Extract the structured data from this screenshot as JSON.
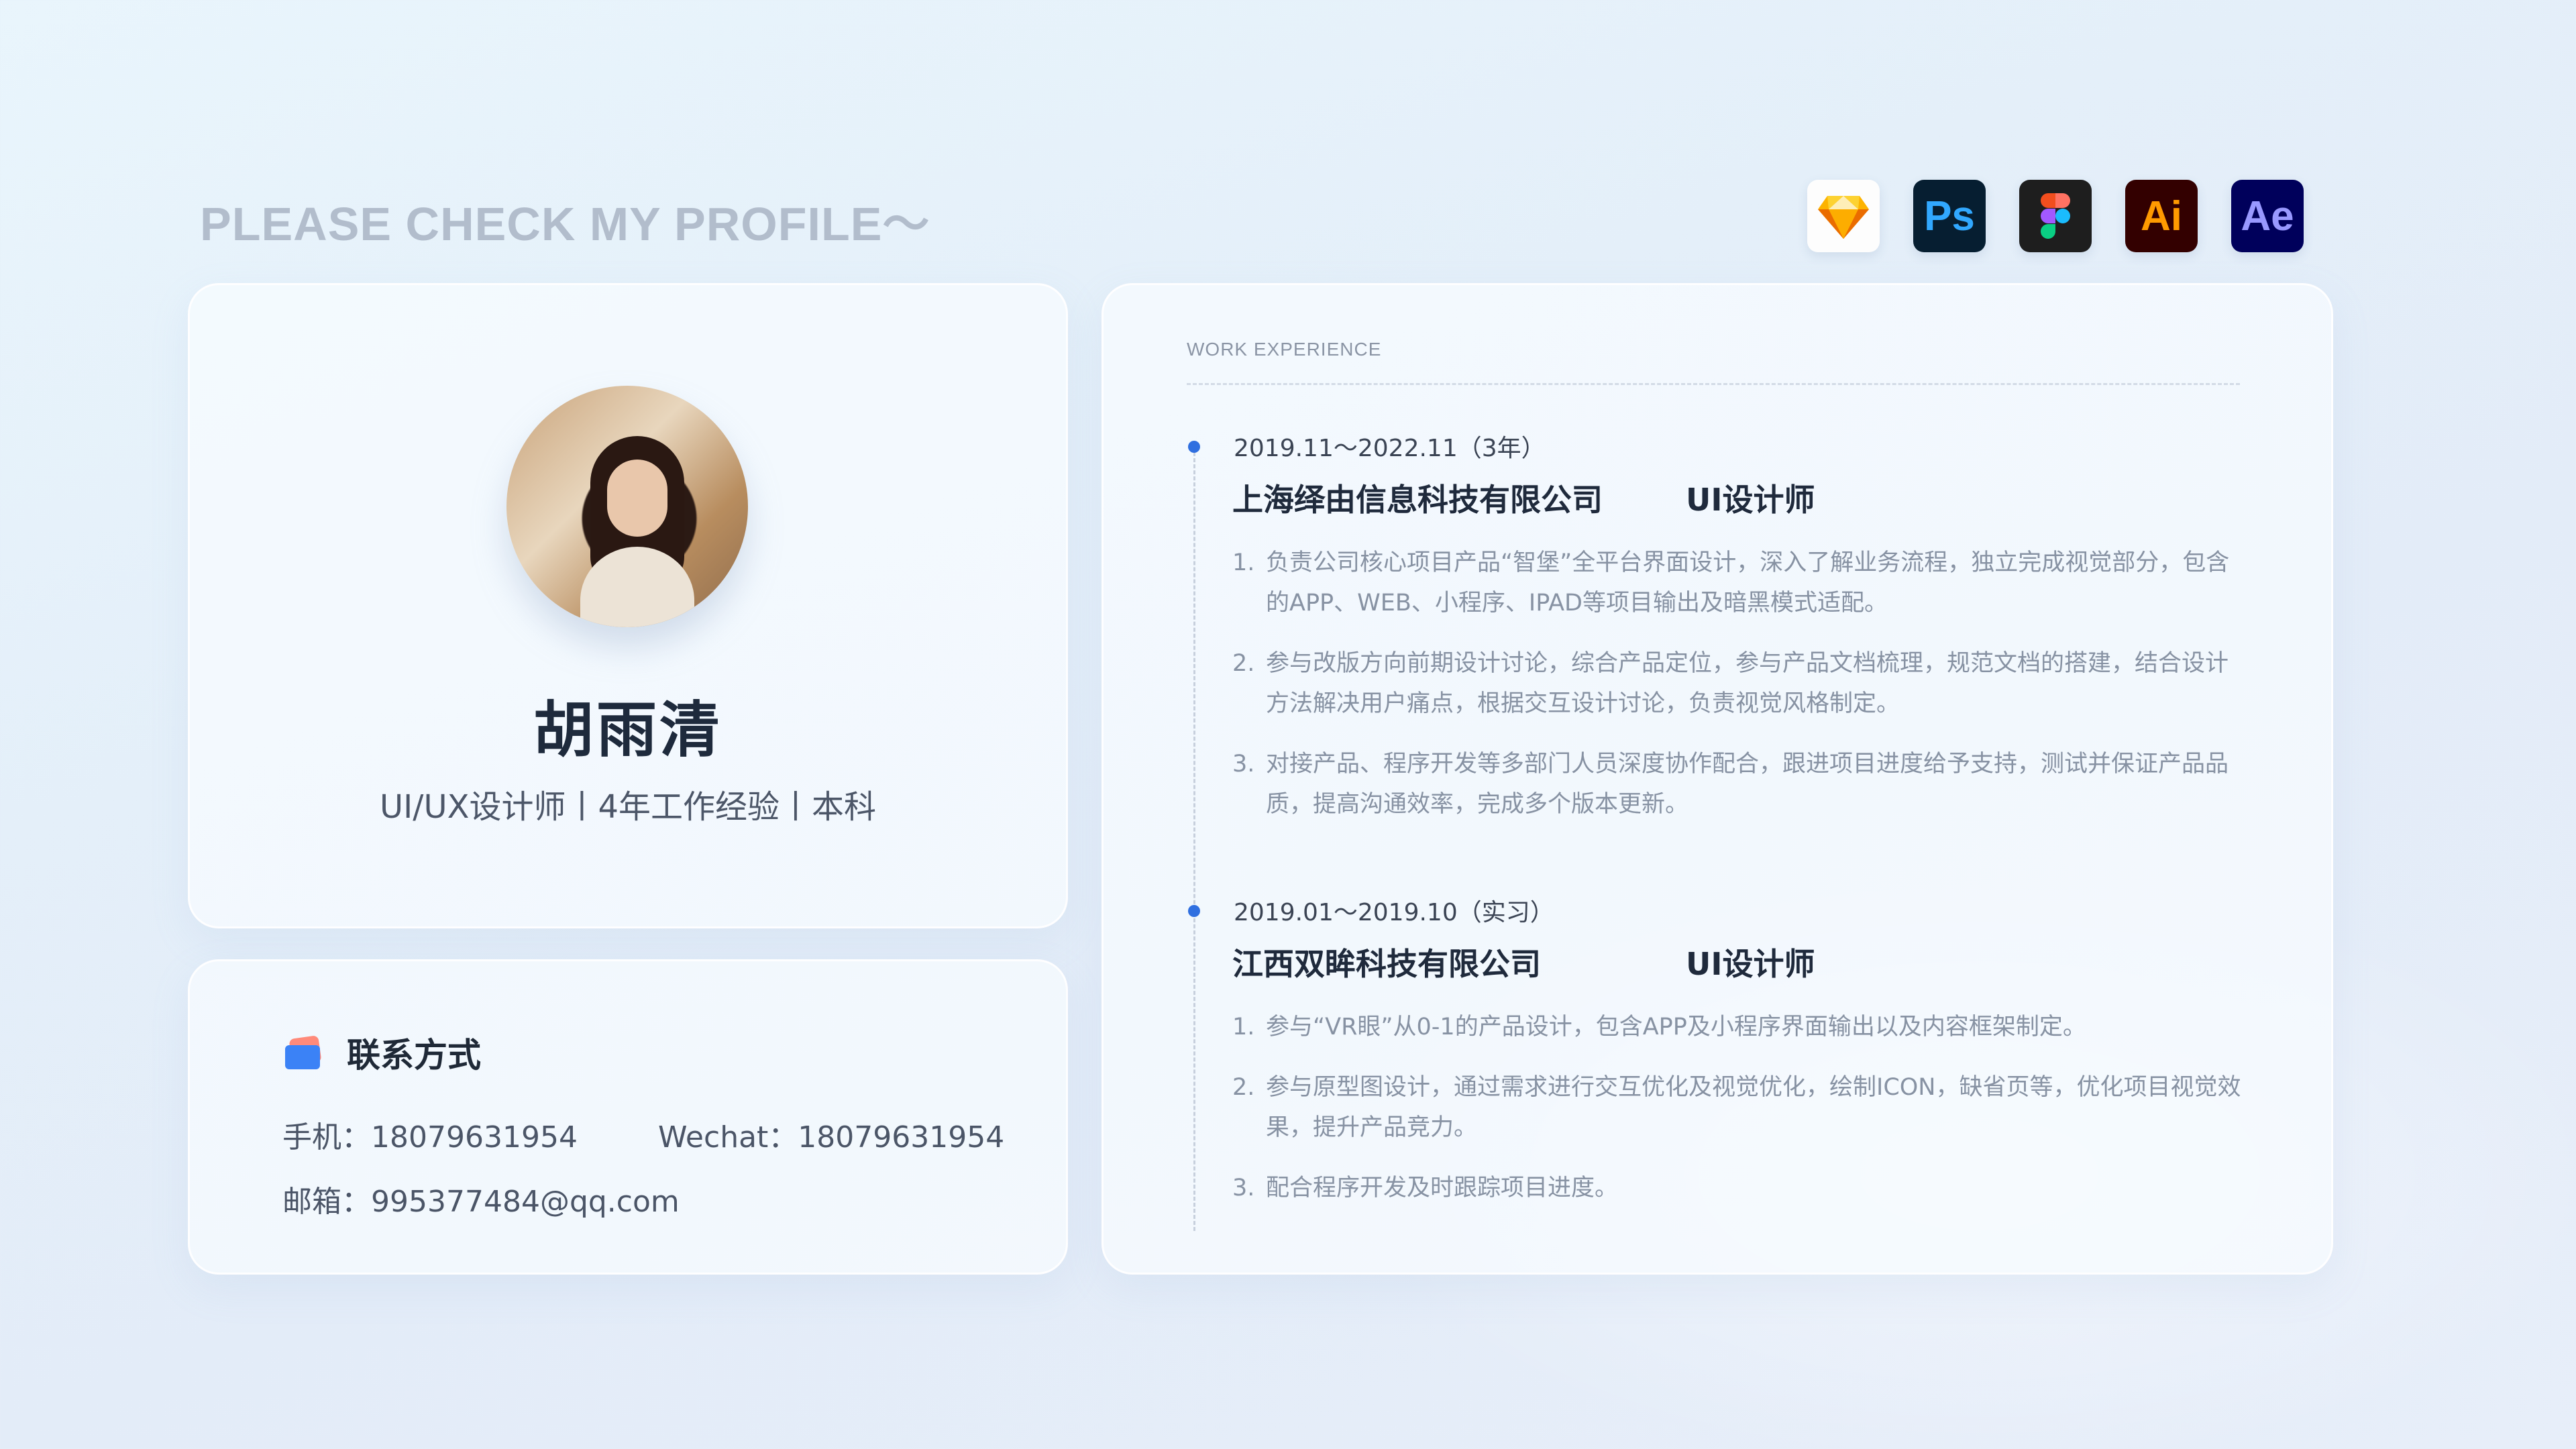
{
  "headline": "PLEASE CHECK MY PROFILE～",
  "tools": [
    {
      "name": "sketch-icon",
      "label": ""
    },
    {
      "name": "photoshop-icon",
      "label": "Ps"
    },
    {
      "name": "figma-icon",
      "label": ""
    },
    {
      "name": "illustrator-icon",
      "label": "Ai"
    },
    {
      "name": "after-effects-icon",
      "label": "Ae"
    }
  ],
  "profile": {
    "name": "胡雨清",
    "subtitle": "UI/UX设计师丨4年工作经验丨本科"
  },
  "contact": {
    "title": "联系方式",
    "phone": "手机：18079631954",
    "wechat": "Wechat：18079631954",
    "email": "邮箱：995377484@qq.com"
  },
  "work": {
    "label": "WORK EXPERIENCE",
    "jobs": [
      {
        "period": "2019.11～2022.11（3年）",
        "company": "上海绎由信息科技有限公司",
        "role": "UI设计师",
        "duties": [
          {
            "num": "1.",
            "text": "负责公司核心项目产品“智堡”全平台界面设计，深入了解业务流程，独立完成视觉部分，包含的APP、WEB、小程序、IPAD等项目输出及暗黑模式适配。"
          },
          {
            "num": "2.",
            "text": "参与改版方向前期设计讨论，综合产品定位，参与产品文档梳理，规范文档的搭建，结合设计方法解决用户痛点，根据交互设计讨论，负责视觉风格制定。"
          },
          {
            "num": "3.",
            "text": "对接产品、程序开发等多部门人员深度协作配合，跟进项目进度给予支持，测试并保证产品品质，提高沟通效率，完成多个版本更新。"
          }
        ]
      },
      {
        "period": "2019.01～2019.10（实习）",
        "company": "江西双眸科技有限公司",
        "role": "UI设计师",
        "duties": [
          {
            "num": "1.",
            "text": "参与“VR眼”从0-1的产品设计，包含APP及小程序界面输出以及内容框架制定。"
          },
          {
            "num": "2.",
            "text": "参与原型图设计，通过需求进行交互优化及视觉优化，绘制ICON，缺省页等，优化项目视觉效果，提升产品竞力。"
          },
          {
            "num": "3.",
            "text": "配合程序开发及时跟踪项目进度。"
          }
        ]
      }
    ]
  }
}
